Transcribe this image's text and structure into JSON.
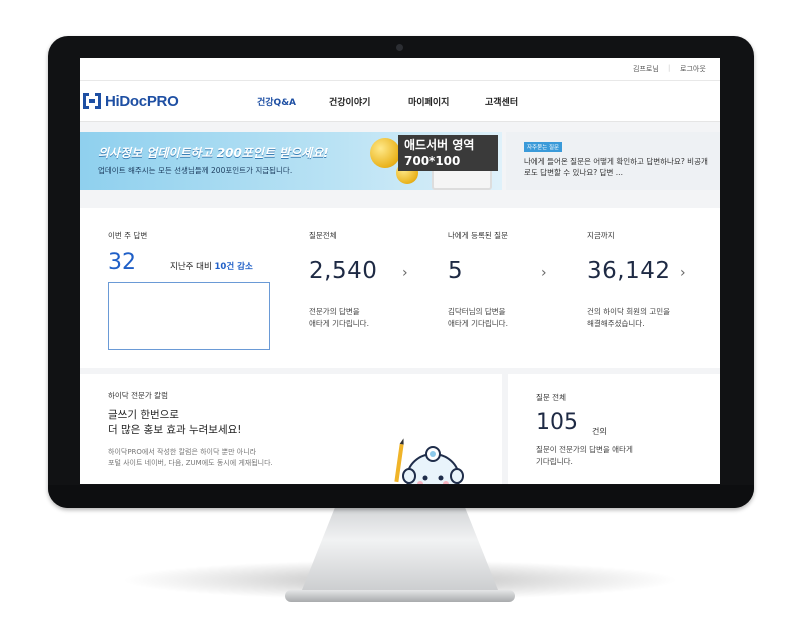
{
  "util": {
    "links": [
      "김프로님",
      "로그아웃"
    ]
  },
  "nav": {
    "logo_text": "HiDocPRO",
    "menu": [
      "건강Q&A",
      "건강이야기",
      "마이페이지",
      "고객센터"
    ]
  },
  "ad_banner": {
    "headline": "의사정보 업데이트하고 200포인트 받으세요!",
    "subline": "업데이트 해주시는 모든 선생님들께 200포인트가 지급됩니다.",
    "ad_label_line1": "애드서버 영역",
    "ad_label_line2": "700*100"
  },
  "faq": {
    "badge": "자주묻는 질문",
    "question": "나에게 들어온 질문은 어떻게 확인하고 답변하나요? 비공개로도 답변할 수 있나요? 답변 ..."
  },
  "stats": {
    "week": {
      "label": "이번 주 답변",
      "value": "32",
      "compare_prefix": "지난주 대비",
      "compare_value": "10건 감소"
    },
    "total_questions": {
      "label": "질문전체",
      "value": "2,540",
      "desc_line1": "전문가의 답변을",
      "desc_line2": "애타게 기다립니다."
    },
    "my_questions": {
      "label": "나에게 등록된 질문",
      "value": "5",
      "desc_line1": "김닥터님의 답변을",
      "desc_line2": "애타게 기다립니다."
    },
    "so_far": {
      "label": "지금까지",
      "value": "36,142",
      "desc_line1": "건의 하이닥 회원의 고민을",
      "desc_line2": "해결해주셨습니다."
    }
  },
  "column": {
    "title": "하이닥 전문가 칼럼",
    "headline1": "글쓰기 한번으로",
    "headline2": "더 많은 홍보 효과 누려보세요!",
    "desc1": "하이닥PRO에서 작성한 칼럼은 하이닥 뿐만 아니라",
    "desc2": "포털 사이트 네이버, 다음, ZUM에도 동시에 게재됩니다."
  },
  "total_card": {
    "title": "질문 전체",
    "value": "105",
    "unit": "건의",
    "desc1": "질문이 전문가의 답변을 애타게",
    "desc2": "기다립니다."
  }
}
